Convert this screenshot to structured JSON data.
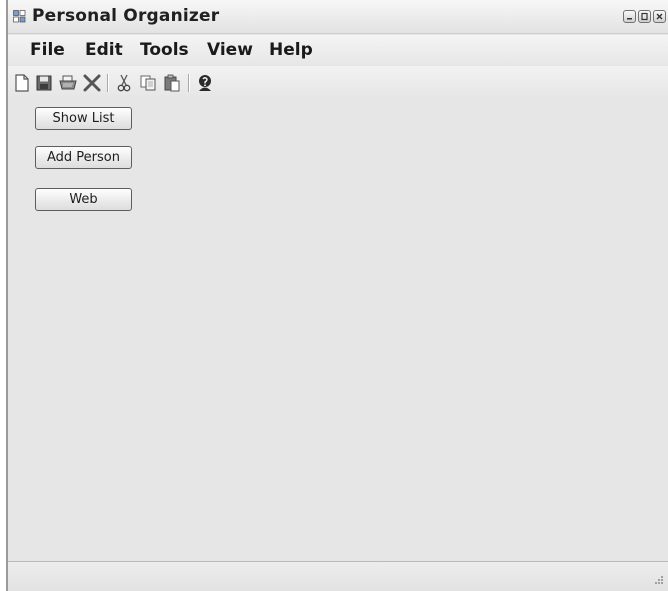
{
  "window": {
    "title": "Personal Organizer"
  },
  "menu": [
    "File",
    "Edit",
    "Tools",
    "View",
    "Help"
  ],
  "toolbar": {
    "icons": [
      "new-icon",
      "save-icon",
      "print-icon",
      "delete-icon",
      "cut-icon",
      "copy-icon",
      "paste-icon",
      "help-person-icon"
    ]
  },
  "buttons": {
    "show_list": "Show List",
    "add_person": "Add Person",
    "web": "Web"
  },
  "colors": {
    "window_bg": "#e6e6e6",
    "text": "#1a1a1a"
  }
}
